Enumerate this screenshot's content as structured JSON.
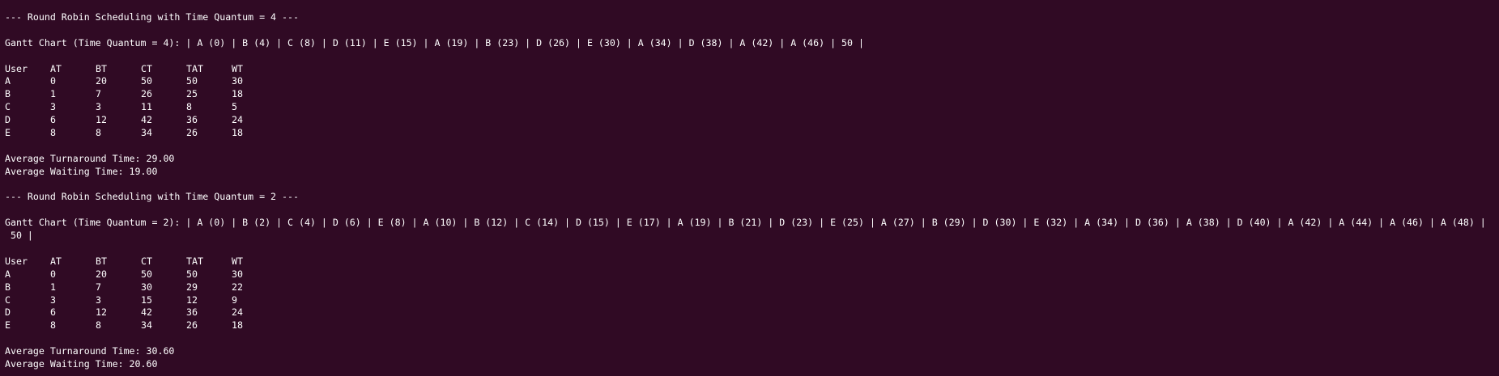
{
  "colors": {
    "background": "#300a24",
    "text": "#ffffff"
  },
  "section1": {
    "header": "--- Round Robin Scheduling with Time Quantum = 4 ---",
    "gantt": "Gantt Chart (Time Quantum = 4): | A (0) | B (4) | C (8) | D (11) | E (15) | A (19) | B (23) | D (26) | E (30) | A (34) | D (38) | A (42) | A (46) | 50 |",
    "columns": [
      "User",
      "AT",
      "BT",
      "CT",
      "TAT",
      "WT"
    ],
    "rows": [
      [
        "A",
        "0",
        "20",
        "50",
        "50",
        "30"
      ],
      [
        "B",
        "1",
        "7",
        "26",
        "25",
        "18"
      ],
      [
        "C",
        "3",
        "3",
        "11",
        "8",
        "5"
      ],
      [
        "D",
        "6",
        "12",
        "42",
        "36",
        "24"
      ],
      [
        "E",
        "8",
        "8",
        "34",
        "26",
        "18"
      ]
    ],
    "avg_tat": "Average Turnaround Time: 29.00",
    "avg_wt": "Average Waiting Time: 19.00"
  },
  "section2": {
    "header": "--- Round Robin Scheduling with Time Quantum = 2 ---",
    "gantt": "Gantt Chart (Time Quantum = 2): | A (0) | B (2) | C (4) | D (6) | E (8) | A (10) | B (12) | C (14) | D (15) | E (17) | A (19) | B (21) | D (23) | E (25) | A (27) | B (29) | D (30) | E (32) | A (34) | D (36) | A (38) | D (40) | A (42) | A (44) | A (46) | A (48) |",
    "gantt_wrap": " 50 |",
    "columns": [
      "User",
      "AT",
      "BT",
      "CT",
      "TAT",
      "WT"
    ],
    "rows": [
      [
        "A",
        "0",
        "20",
        "50",
        "50",
        "30"
      ],
      [
        "B",
        "1",
        "7",
        "30",
        "29",
        "22"
      ],
      [
        "C",
        "3",
        "3",
        "15",
        "12",
        "9"
      ],
      [
        "D",
        "6",
        "12",
        "42",
        "36",
        "24"
      ],
      [
        "E",
        "8",
        "8",
        "34",
        "26",
        "18"
      ]
    ],
    "avg_tat": "Average Turnaround Time: 30.60",
    "avg_wt": "Average Waiting Time: 20.60"
  }
}
